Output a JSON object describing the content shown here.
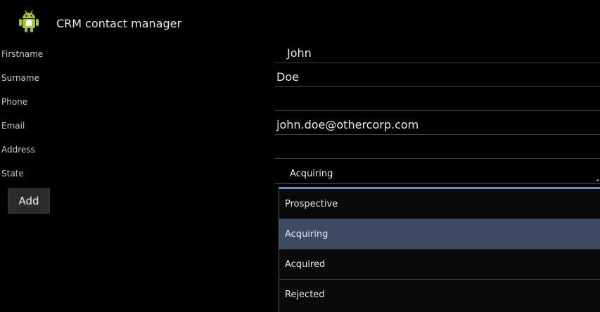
{
  "app": {
    "title": "CRM contact manager",
    "icon": "android-icon"
  },
  "form": {
    "firstname_label": "Firstname",
    "firstname_value": "John",
    "surname_label": "Surname",
    "surname_value": "Doe",
    "phone_label": "Phone",
    "phone_value": "",
    "email_label": "Email",
    "email_value": "john.doe@othercorp.com",
    "address_label": "Address",
    "address_value": "",
    "state_label": "State",
    "state_value": "Acquiring"
  },
  "actions": {
    "add_label": "Add"
  },
  "dropdown": {
    "options": [
      "Prospective",
      "Acquiring",
      "Acquired",
      "Rejected"
    ],
    "selected": "Acquiring"
  },
  "colors": {
    "background": "#000000",
    "selected_row": "#3e4b62",
    "dropdown_accent": "#6a8fc6",
    "android_green": "#a4c639"
  }
}
